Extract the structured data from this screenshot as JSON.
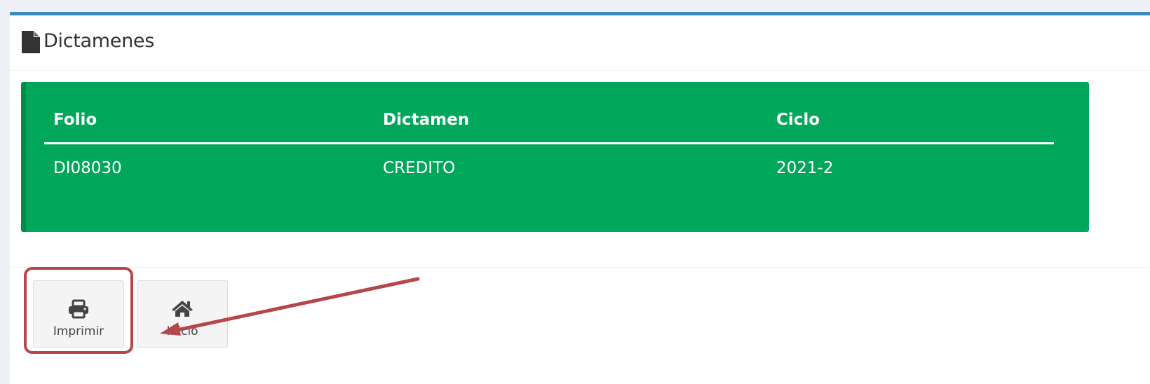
{
  "panel": {
    "title": "Dictamenes",
    "title_icon": "file-icon"
  },
  "table": {
    "headers": {
      "folio": "Folio",
      "dictamen": "Dictamen",
      "ciclo": "Ciclo"
    },
    "rows": [
      {
        "folio": "DI08030",
        "dictamen": "CREDITO",
        "ciclo": "2021-2"
      }
    ],
    "background_color": "#00a65a"
  },
  "buttons": {
    "print": {
      "label": "Imprimir",
      "icon": "print-icon"
    },
    "home": {
      "label": "Inicio",
      "icon": "home-icon"
    }
  },
  "annotation": {
    "highlight_color": "#b5464a",
    "arrow_color": "#b5464a"
  }
}
